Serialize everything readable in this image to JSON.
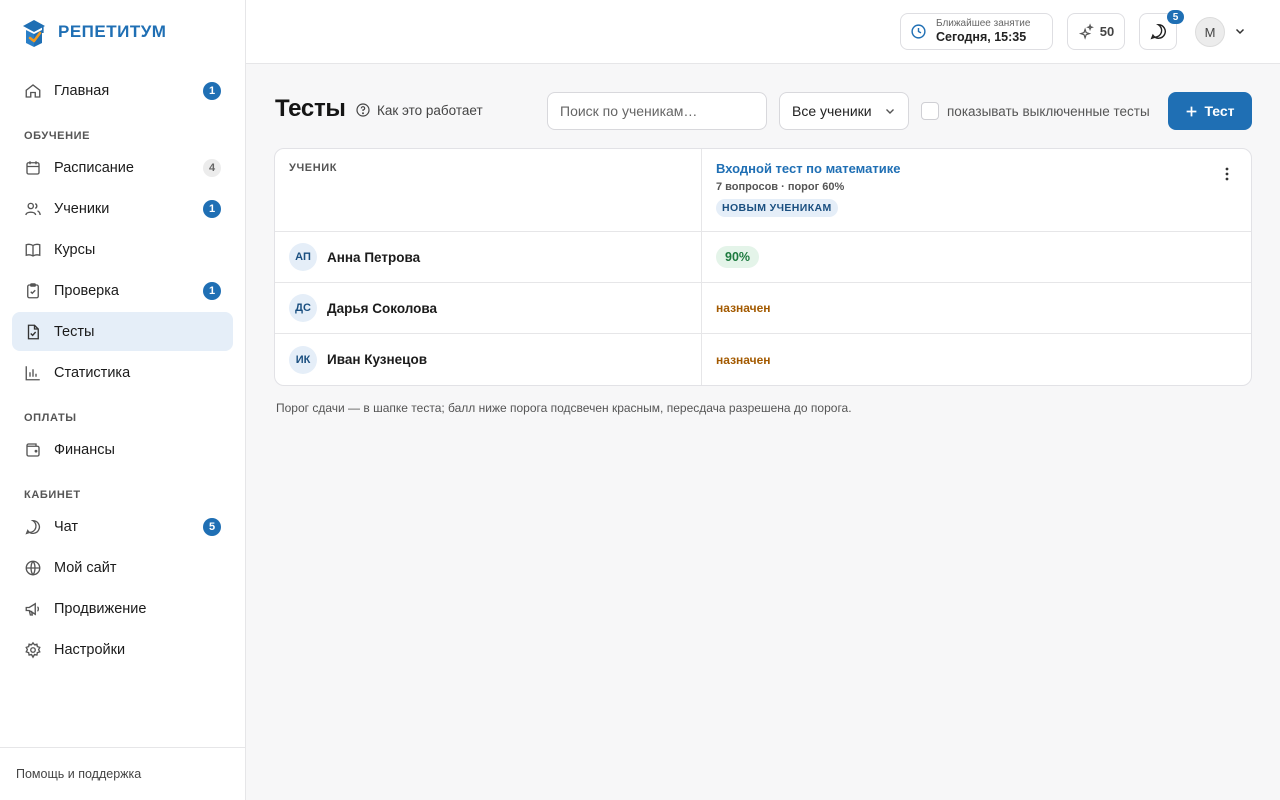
{
  "brand": {
    "name": "РЕПЕТИТУМ"
  },
  "sidebar": {
    "items": [
      {
        "label": "Главная",
        "badge": "1",
        "icon": "home-icon"
      },
      {
        "section": "ОБУЧЕНИЕ"
      },
      {
        "label": "Расписание",
        "badge": "4",
        "icon": "calendar-icon"
      },
      {
        "label": "Ученики",
        "badge": "1",
        "icon": "users-icon"
      },
      {
        "label": "Курсы",
        "icon": "book-icon"
      },
      {
        "label": "Проверка",
        "badge": "1",
        "icon": "clipboard-check-icon"
      },
      {
        "label": "Тесты",
        "icon": "file-check-icon",
        "active": true
      },
      {
        "label": "Статистика",
        "icon": "bar-chart-icon"
      },
      {
        "section": "ОПЛАТЫ"
      },
      {
        "label": "Финансы",
        "icon": "wallet-icon"
      },
      {
        "section": "КАБИНЕТ"
      },
      {
        "label": "Чат",
        "badge": "5",
        "icon": "chat-icon"
      },
      {
        "label": "Мой сайт",
        "icon": "globe-icon"
      },
      {
        "label": "Продвижение",
        "icon": "megaphone-icon"
      },
      {
        "label": "Настройки",
        "icon": "gear-icon"
      }
    ],
    "footer": "Помощь и поддержка"
  },
  "header": {
    "next_lesson_label": "Ближайшее занятие",
    "next_lesson_value": "Сегодня, 15:35",
    "points": "50",
    "chat_badge": "5",
    "avatar_initial": "M"
  },
  "main": {
    "title": "Тесты",
    "how_it_works": "Как это работает",
    "search_placeholder": "Поиск по ученикам…",
    "filter_value": "Все ученики",
    "show_disabled_label": "показывать выключенные тесты",
    "add_button": "Тест",
    "table": {
      "student_header": "УЧЕНИК",
      "test": {
        "title": "Входной тест по математике",
        "meta": "7 вопросов · порог 60%",
        "tag": "НОВЫМ УЧЕНИКАМ"
      },
      "rows": [
        {
          "initials": "АП",
          "name": "Анна Петрова",
          "result": "90%",
          "type": "score"
        },
        {
          "initials": "ДС",
          "name": "Дарья Соколова",
          "result": "назначен",
          "type": "assigned"
        },
        {
          "initials": "ИК",
          "name": "Иван Кузнецов",
          "result": "назначен",
          "type": "assigned"
        }
      ]
    },
    "note": "Порог сдачи — в шапке теста; балл ниже порога подсвечен красным, пересдача разрешена до порога."
  },
  "colors": {
    "accent": "#1f6fb4",
    "score_bg": "#e4f4e9",
    "score_text": "#1c7a3e",
    "assigned_text": "#a35a00"
  }
}
